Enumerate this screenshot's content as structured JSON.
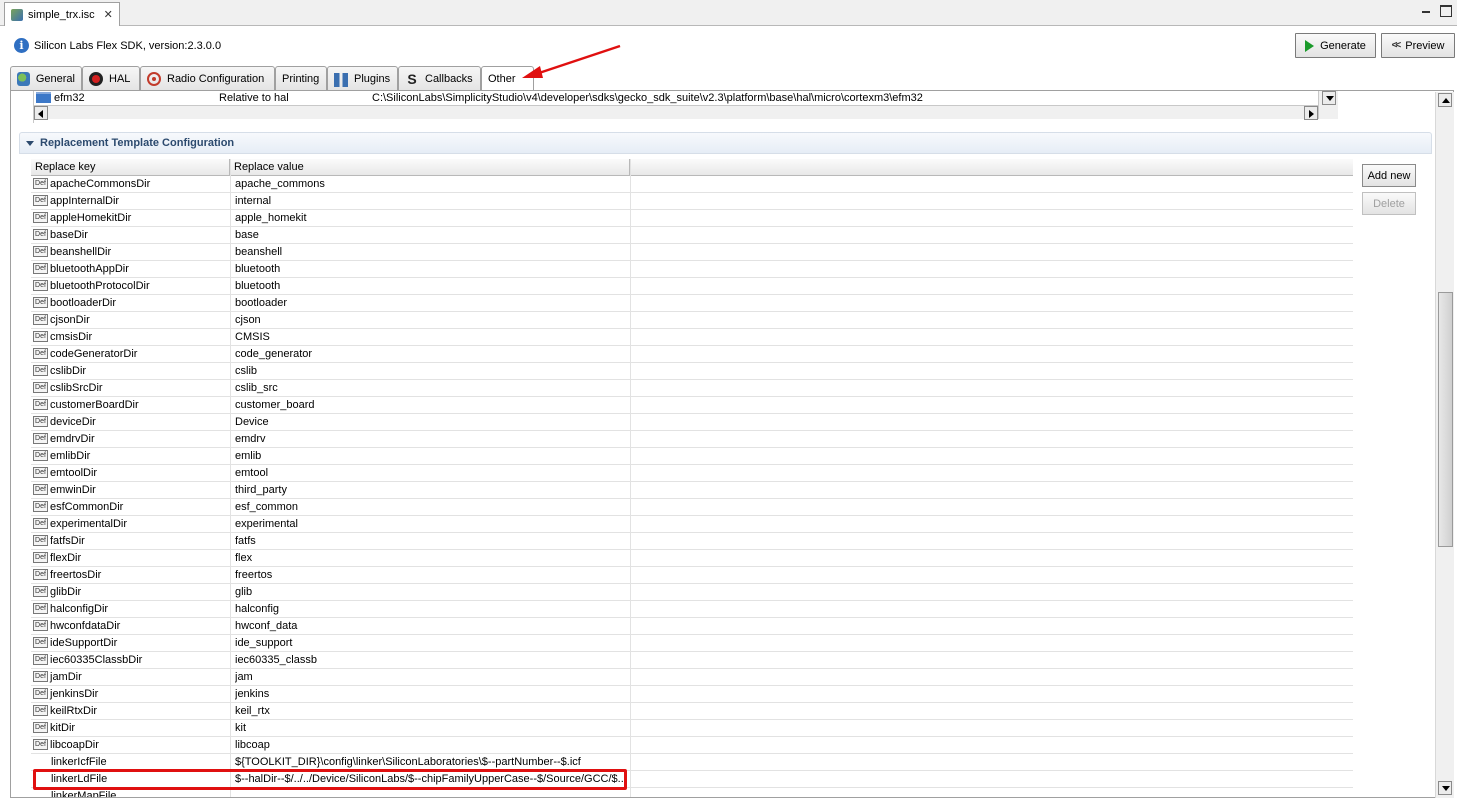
{
  "editor": {
    "file_tab": "simple_trx.isc",
    "close_glyph": "✕"
  },
  "header": {
    "sdk_title": "Silicon Labs Flex SDK, version:2.3.0.0",
    "generate_label": "Generate",
    "preview_label": "Preview"
  },
  "tabs": {
    "general": "General",
    "hal": "HAL",
    "radio": "Radio Configuration",
    "printing": "Printing",
    "plugins": "Plugins",
    "callbacks": "Callbacks",
    "other": "Other",
    "active": "Other"
  },
  "paths_table": {
    "name": "efm32",
    "relative": "Relative to hal",
    "path": "C:\\SiliconLabs\\SimplicityStudio\\v4\\developer\\sdks\\gecko_sdk_suite\\v2.3\\platform\\base\\hal\\micro\\cortexm3\\efm32"
  },
  "section": {
    "title": "Replacement Template Configuration"
  },
  "table": {
    "col_key": "Replace key",
    "col_value": "Replace value",
    "def_badge": "Def",
    "rows": [
      {
        "key": "apacheCommonsDir",
        "value": "apache_commons",
        "def": true
      },
      {
        "key": "appInternalDir",
        "value": "internal",
        "def": true
      },
      {
        "key": "appleHomekitDir",
        "value": "apple_homekit",
        "def": true
      },
      {
        "key": "baseDir",
        "value": "base",
        "def": true
      },
      {
        "key": "beanshellDir",
        "value": "beanshell",
        "def": true
      },
      {
        "key": "bluetoothAppDir",
        "value": "bluetooth",
        "def": true
      },
      {
        "key": "bluetoothProtocolDir",
        "value": "bluetooth",
        "def": true
      },
      {
        "key": "bootloaderDir",
        "value": "bootloader",
        "def": true
      },
      {
        "key": "cjsonDir",
        "value": "cjson",
        "def": true
      },
      {
        "key": "cmsisDir",
        "value": "CMSIS",
        "def": true
      },
      {
        "key": "codeGeneratorDir",
        "value": "code_generator",
        "def": true
      },
      {
        "key": "cslibDir",
        "value": "cslib",
        "def": true
      },
      {
        "key": "cslibSrcDir",
        "value": "cslib_src",
        "def": true
      },
      {
        "key": "customerBoardDir",
        "value": "customer_board",
        "def": true
      },
      {
        "key": "deviceDir",
        "value": "Device",
        "def": true
      },
      {
        "key": "emdrvDir",
        "value": "emdrv",
        "def": true
      },
      {
        "key": "emlibDir",
        "value": "emlib",
        "def": true
      },
      {
        "key": "emtoolDir",
        "value": "emtool",
        "def": true
      },
      {
        "key": "emwinDir",
        "value": "third_party",
        "def": true
      },
      {
        "key": "esfCommonDir",
        "value": "esf_common",
        "def": true
      },
      {
        "key": "experimentalDir",
        "value": "experimental",
        "def": true
      },
      {
        "key": "fatfsDir",
        "value": "fatfs",
        "def": true
      },
      {
        "key": "flexDir",
        "value": "flex",
        "def": true
      },
      {
        "key": "freertosDir",
        "value": "freertos",
        "def": true
      },
      {
        "key": "glibDir",
        "value": "glib",
        "def": true
      },
      {
        "key": "halconfigDir",
        "value": "halconfig",
        "def": true
      },
      {
        "key": "hwconfdataDir",
        "value": "hwconf_data",
        "def": true
      },
      {
        "key": "ideSupportDir",
        "value": "ide_support",
        "def": true
      },
      {
        "key": "iec60335ClassbDir",
        "value": "iec60335_classb",
        "def": true
      },
      {
        "key": "jamDir",
        "value": "jam",
        "def": true
      },
      {
        "key": "jenkinsDir",
        "value": "jenkins",
        "def": true
      },
      {
        "key": "keilRtxDir",
        "value": "keil_rtx",
        "def": true
      },
      {
        "key": "kitDir",
        "value": "kit",
        "def": true
      },
      {
        "key": "libcoapDir",
        "value": "libcoap",
        "def": true
      },
      {
        "key": "linkerIcfFile",
        "value": "${TOOLKIT_DIR}\\config\\linker\\SiliconLaboratories\\$--partNumber--$.icf",
        "def": false
      },
      {
        "key": "linkerLdFile",
        "value": "$--halDir--$/../../Device/SiliconLabs/$--chipFamilyUpperCase--$/Source/GCC/$...",
        "def": false
      },
      {
        "key": "linkerMapFile",
        "value": "",
        "def": false
      }
    ]
  },
  "side_buttons": {
    "add_new": "Add new",
    "delete": "Delete"
  },
  "colors": {
    "annotation_red": "#e01010",
    "generate_green": "#1a9a2a",
    "section_title": "#2c4a6e"
  }
}
